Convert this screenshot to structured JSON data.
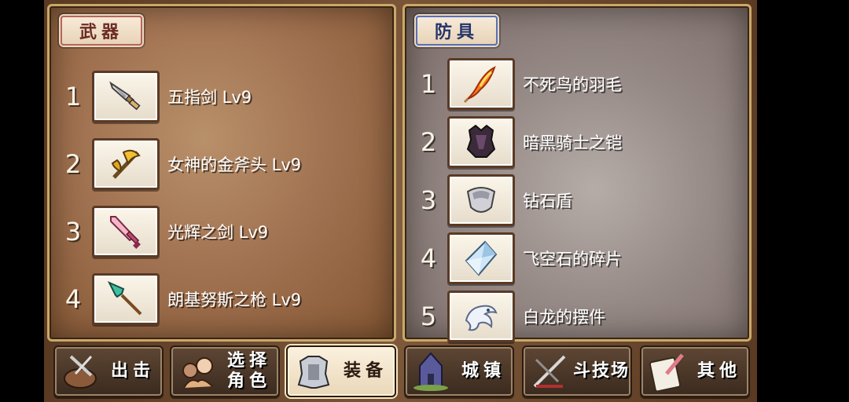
{
  "weapons": {
    "title": "武器",
    "items": [
      {
        "index": "1",
        "name": "五指剑 Lv9",
        "icon": "dagger-icon"
      },
      {
        "index": "2",
        "name": "女神的金斧头 Lv9",
        "icon": "golden-axe-icon"
      },
      {
        "index": "3",
        "name": "光辉之剑 Lv9",
        "icon": "sword-icon"
      },
      {
        "index": "4",
        "name": "朗基努斯之枪 Lv9",
        "icon": "spear-icon"
      }
    ]
  },
  "armor": {
    "title": "防具",
    "items": [
      {
        "index": "1",
        "name": "不死鸟的羽毛",
        "icon": "phoenix-feather-icon"
      },
      {
        "index": "2",
        "name": "暗黑骑士之铠",
        "icon": "dark-armor-icon"
      },
      {
        "index": "3",
        "name": "钻石盾",
        "icon": "diamond-shield-icon"
      },
      {
        "index": "4",
        "name": "飞空石的碎片",
        "icon": "crystal-shard-icon"
      },
      {
        "index": "5",
        "name": "白龙的摆件",
        "icon": "white-dragon-icon"
      }
    ]
  },
  "nav": [
    {
      "label": "出击",
      "icon": "sortie-icon",
      "active": false
    },
    {
      "label": "选择\n角色",
      "icon": "character-select-icon",
      "active": false
    },
    {
      "label": "装备",
      "icon": "equipment-icon",
      "active": true
    },
    {
      "label": "城镇",
      "icon": "town-icon",
      "active": false
    },
    {
      "label": "斗技场",
      "icon": "arena-icon",
      "active": false
    },
    {
      "label": "其他",
      "icon": "other-icon",
      "active": false
    }
  ]
}
